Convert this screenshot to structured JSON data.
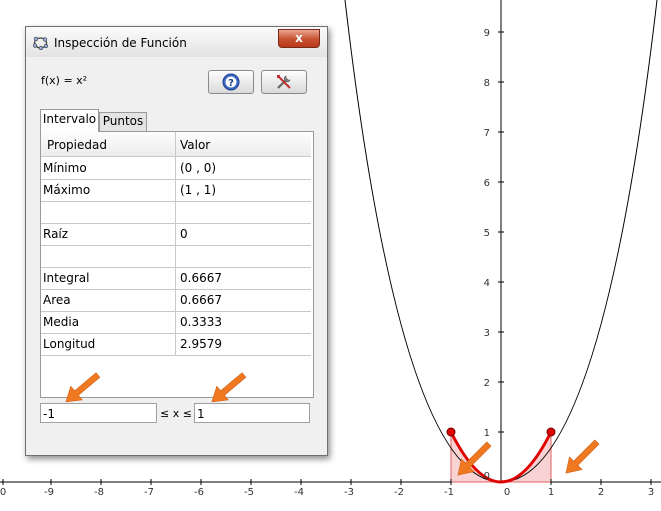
{
  "dialog": {
    "title": "Inspección de Función",
    "function_label": "f(x) = x²",
    "close_label": "x",
    "tabs": [
      {
        "label": "Intervalo",
        "active": true
      },
      {
        "label": "Puntos",
        "active": false
      }
    ],
    "table": {
      "headers": [
        "Propiedad",
        "Valor"
      ],
      "rows": [
        {
          "prop": "Mínimo",
          "value": "(0 , 0)"
        },
        {
          "prop": "Máximo",
          "value": "(1 , 1)"
        },
        {
          "prop": "",
          "value": ""
        },
        {
          "prop": "Raíz",
          "value": "0"
        },
        {
          "prop": "",
          "value": ""
        },
        {
          "prop": "Integral",
          "value": "0.6667"
        },
        {
          "prop": "Area",
          "value": "0.6667"
        },
        {
          "prop": "Media",
          "value": "0.3333"
        },
        {
          "prop": "Longitud",
          "value": "2.9579"
        }
      ]
    },
    "interval": {
      "min": "-1",
      "relation": "≤ x ≤",
      "max": "1"
    }
  },
  "graph": {
    "x_ticks": [
      "0",
      "-9",
      "-8",
      "-7",
      "-6",
      "-5",
      "-4",
      "-3",
      "-2",
      "-1",
      "0",
      "1",
      "2",
      "3"
    ],
    "y_ticks": [
      "1",
      "2",
      "3",
      "4",
      "5",
      "6",
      "7",
      "8",
      "9"
    ],
    "y_zero": "0",
    "curve_color": "#000000",
    "highlight_color": "#e00000",
    "fill_color": "#f8c8c8",
    "arrow_color": "#f07820"
  }
}
